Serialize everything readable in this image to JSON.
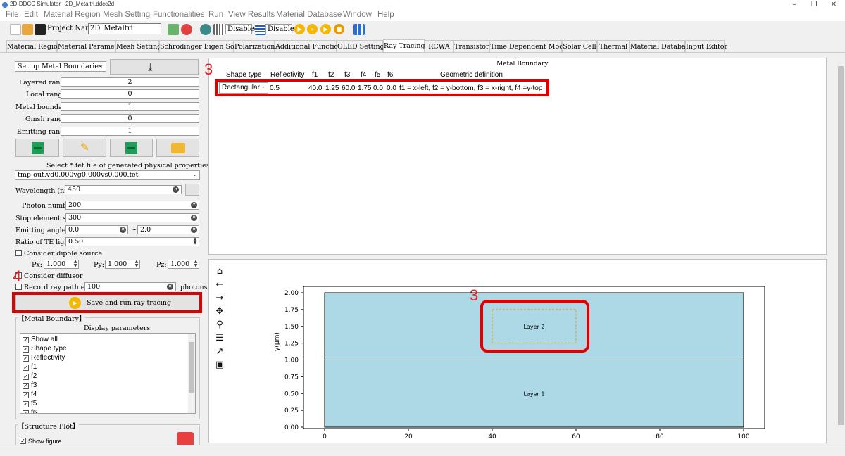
{
  "window": {
    "title": "2D-DDCC Simulator - 2D_Metaltri.ddcc2d"
  },
  "menu": [
    "File",
    "Edit",
    "Material Region",
    "Mesh Setting",
    "Functionalities",
    "Run",
    "View Results",
    "Material Database",
    "Window",
    "Help"
  ],
  "toolbar": {
    "project_label": "Project Name:",
    "project_value": "2D_Metaltri",
    "disabled1": "Disabled",
    "disabled2": "Disabled"
  },
  "tabs": [
    "Material Region",
    "Material Parameter",
    "Mesh Setting",
    "Schrodinger Eigen Solver",
    "Polarization",
    "Additional Functions",
    "OLED Setting",
    "Ray Tracing",
    "RCWA",
    "Transistor",
    "Time Dependent Module",
    "Solar Cell",
    "Thermal",
    "Material Database",
    "Input Editor"
  ],
  "active_tab": "Ray Tracing",
  "left": {
    "setup_combo": "Set up Metal Boundaries",
    "ranges": [
      {
        "label": "Layered range:",
        "value": "2"
      },
      {
        "label": "Local range:",
        "value": "0"
      },
      {
        "label": "Metal boundary:",
        "value": "1"
      },
      {
        "label": "Gmsh range:",
        "value": "0"
      },
      {
        "label": "Emitting range:",
        "value": "1"
      }
    ],
    "fet_label": "Select *.fet file of generated physical properties:",
    "fet_file": "tmp-out.vd0.000vg0.000vs0.000.fet",
    "wavelength_label": "Wavelength (nm):",
    "wavelength": "450",
    "photon_label": "Photon number:",
    "photon": "200",
    "stop_label": "Stop element step:",
    "stop": "300",
    "angle_label": "Emitting angle(ϕ):",
    "angle_min": "0.0",
    "angle_sep": "~",
    "angle_max": "2.0",
    "te_label": "Ratio of TE light:",
    "te": "0.50",
    "dipole_label": "Consider dipole source",
    "px_label": "Px:",
    "px": "1.000",
    "py_label": "Py:",
    "py": "1.000",
    "pz_label": "Pz:",
    "pz": "1.000",
    "diffusor_label": "Consider diffusor",
    "record_label": "Record ray path every",
    "record": "100",
    "record_unit": "photons",
    "run_button": "Save and run ray tracing",
    "metal_group": "【Metal Boundary】",
    "display_params": "Display parameters",
    "params": [
      "Show all",
      "Shape type",
      "Reflectivity",
      "f1",
      "f2",
      "f3",
      "f4",
      "f5",
      "f6"
    ],
    "structure_group": "【Structure Plot】",
    "show_figure": "Show figure"
  },
  "table": {
    "title": "Metal Boundary",
    "headers": [
      "Shape type",
      "Reflectivity",
      "f1",
      "f2",
      "f3",
      "f4",
      "f5",
      "f6",
      "Geometric definition"
    ],
    "row": [
      "Rectangular",
      "0.5",
      "40.0",
      "1.25",
      "60.0",
      "1.75",
      "0.0",
      "0.0",
      "f1 = x-left, f2 = y-bottom, f3 = x-right, f4 =y-top"
    ]
  },
  "annotations": {
    "a": "3",
    "b": "4",
    "c": "3"
  },
  "colors": {
    "accent_red": "#e00000",
    "layer_fill": "#add8e6",
    "metal_dash": "#e0a020"
  },
  "chart_data": {
    "type": "diagram",
    "title": "",
    "xlabel": "",
    "ylabel": "y(µm)",
    "xlim": [
      0,
      100
    ],
    "ylim": [
      0,
      2.0
    ],
    "xticks": [
      "0",
      "20",
      "40",
      "60",
      "80",
      "100"
    ],
    "yticks": [
      "0.00",
      "0.25",
      "0.50",
      "0.75",
      "1.00",
      "1.25",
      "1.50",
      "1.75",
      "2.00"
    ],
    "layers": [
      {
        "name": "Layer 1",
        "x": [
          0,
          100
        ],
        "y": [
          0,
          1.0
        ]
      },
      {
        "name": "Layer 2",
        "x": [
          0,
          100
        ],
        "y": [
          1.0,
          2.0
        ]
      }
    ],
    "metal": {
      "x": [
        40,
        60
      ],
      "y": [
        1.25,
        1.75
      ]
    }
  }
}
